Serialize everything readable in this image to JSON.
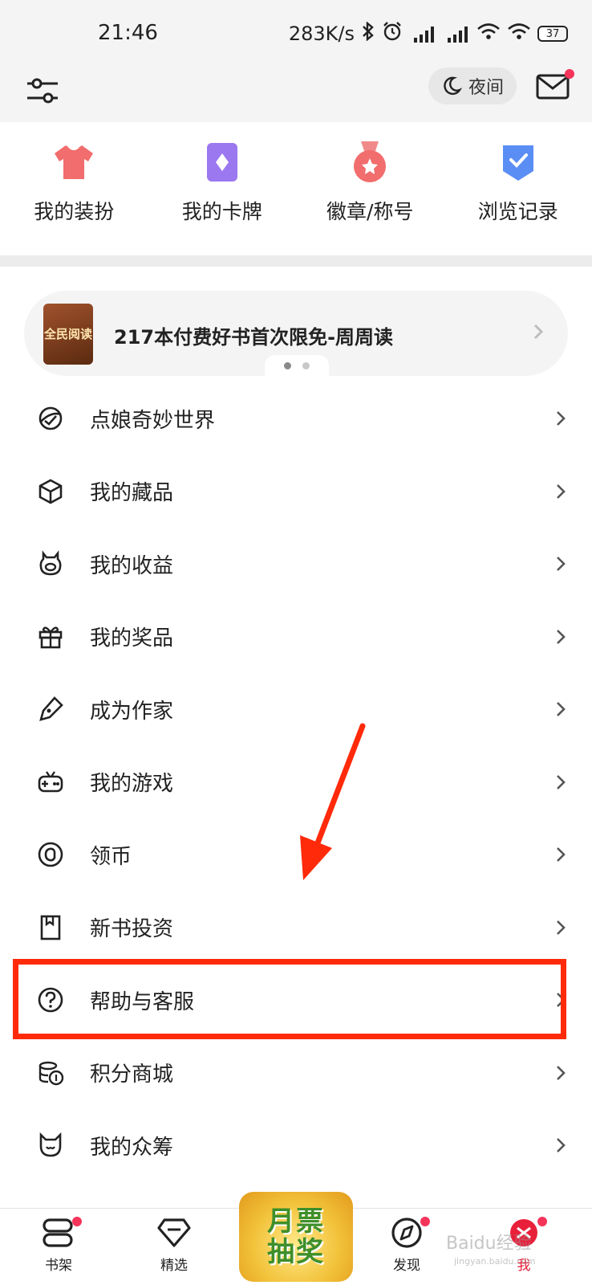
{
  "status_bar": {
    "time": "21:46",
    "speed": "283K/s",
    "battery": "37"
  },
  "top_bar": {
    "night_label": "夜间"
  },
  "quick_actions": [
    {
      "label": "我的装扮",
      "icon": "shirt-icon"
    },
    {
      "label": "我的卡牌",
      "icon": "card-icon"
    },
    {
      "label": "徽章/称号",
      "icon": "medal-icon"
    },
    {
      "label": "浏览记录",
      "icon": "history-icon"
    }
  ],
  "banner": {
    "book_title": "全民阅读",
    "text": "217本付费好书首次限免-周周读"
  },
  "menu": [
    {
      "label": "点娘奇妙世界",
      "icon": "world-icon"
    },
    {
      "label": "我的藏品",
      "icon": "cube-icon"
    },
    {
      "label": "我的收益",
      "icon": "piggy-icon"
    },
    {
      "label": "我的奖品",
      "icon": "gift-icon"
    },
    {
      "label": "成为作家",
      "icon": "pen-icon"
    },
    {
      "label": "我的游戏",
      "icon": "gamepad-icon"
    },
    {
      "label": "领币",
      "icon": "coin-icon"
    },
    {
      "label": "新书投资",
      "icon": "bookmark-icon"
    },
    {
      "label": "帮助与客服",
      "icon": "help-icon"
    },
    {
      "label": "积分商城",
      "icon": "coins-icon"
    },
    {
      "label": "我的众筹",
      "icon": "cat-icon"
    }
  ],
  "tabbar": {
    "bookshelf": "书架",
    "featured": "精选",
    "promo": "月票抽奖",
    "discover": "发现",
    "me": "我"
  },
  "watermark": {
    "text": "Baidu经验",
    "sub": "jingyan.baidu.com"
  },
  "colors": {
    "accent": "#e8203a",
    "highlight": "#ff2a0a",
    "dot": "#f5345a"
  }
}
